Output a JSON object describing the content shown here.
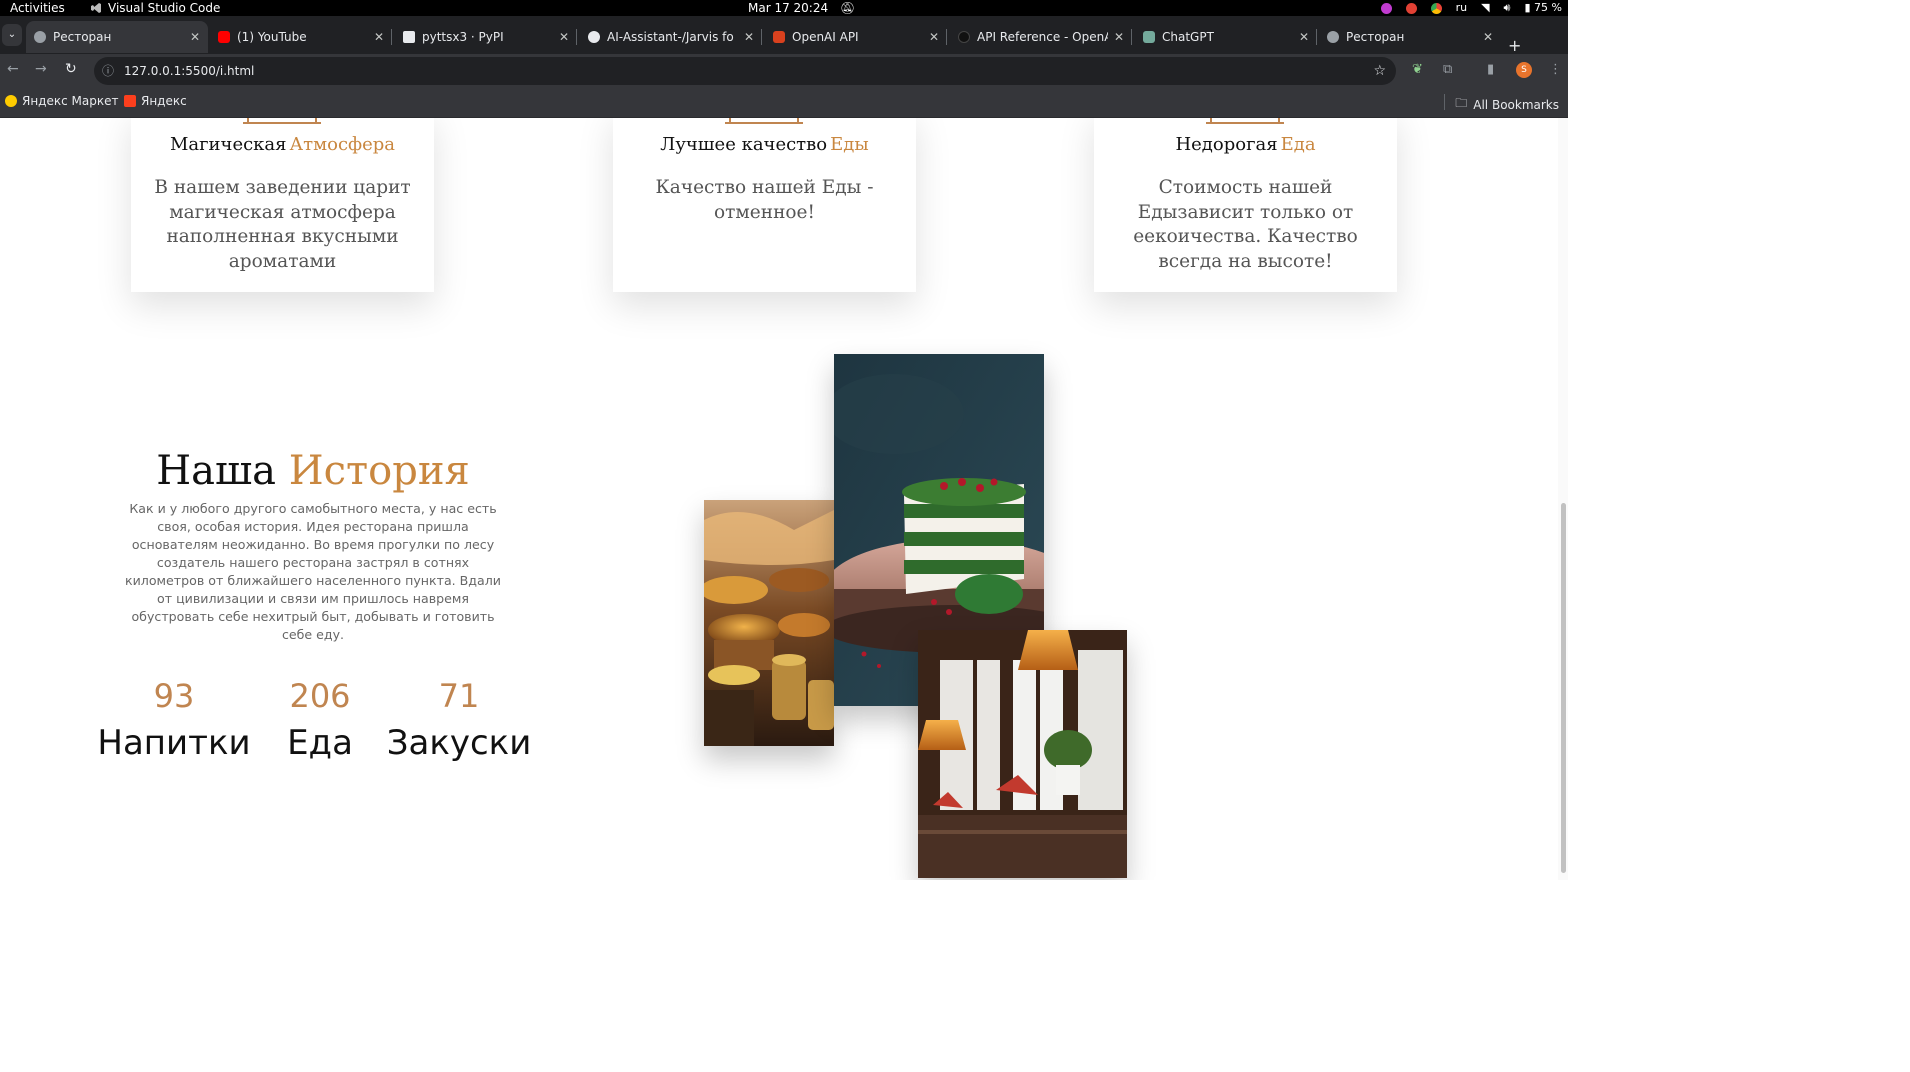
{
  "os_bar": {
    "activities": "Activities",
    "app_name": "Visual Studio Code",
    "clock": "Mar 17  20:24",
    "language": "ru",
    "battery": "75 %"
  },
  "browser": {
    "tabs": [
      {
        "label": "Ресторан",
        "active": true,
        "favicon_color": "#9aa0a6"
      },
      {
        "label": "(1) YouTube",
        "active": false,
        "favicon_color": "#ff0000"
      },
      {
        "label": "pyttsx3 · PyPI",
        "active": false,
        "favicon_color": "#e8eaed"
      },
      {
        "label": "AI-Assistant-/Jarvis fo",
        "active": false,
        "favicon_color": "#e8eaed"
      },
      {
        "label": "OpenAI API",
        "active": false,
        "favicon_color": "#d9411e"
      },
      {
        "label": "API Reference - OpenA",
        "active": false,
        "favicon_color": "#111111"
      },
      {
        "label": "ChatGPT",
        "active": false,
        "favicon_color": "#74aa9c"
      },
      {
        "label": "Ресторан",
        "active": false,
        "favicon_color": "#9aa0a6"
      }
    ],
    "url": "127.0.0.1:5500/i.html",
    "profile_initial": "S",
    "bookmarks": [
      {
        "label": "Яндекс Маркет",
        "icon_color": "#ffcc00"
      },
      {
        "label": "Яндекс",
        "icon_color": "#fc3f1d"
      }
    ],
    "all_bookmarks": "All Bookmarks"
  },
  "features": [
    {
      "title": "Магическая",
      "accent": "Атмосфера",
      "text": "В нашем заведении царит магическая атмосфера наполненная вкусными ароматами"
    },
    {
      "title": "Лучшее качество",
      "accent": "Еды",
      "text": "Качество нашей Еды - отменное!"
    },
    {
      "title": "Недорогая",
      "accent": "Еда",
      "text": "Стоимость нашей Едызависит только от еекоичества. Качество всегда на высоте!"
    }
  ],
  "history": {
    "title": "Наша",
    "accent": "История",
    "text": "Как и у любого другого самобытного места, у нас есть своя, особая история. Идея ресторана пришла основателям неожиданно. Во время прогулки по лесу создатель нашего ресторана застрял в сотнях километров от ближайшего населенного пункта. Вдали от цивилизации и связи им пришлось навремя обустровать себе нехитрый быт, добывать и готовить себе еду."
  },
  "stats": [
    {
      "value": "93",
      "label": "Напитки"
    },
    {
      "value": "206",
      "label": "Еда"
    },
    {
      "value": "71",
      "label": "Закуски"
    }
  ],
  "colors": {
    "accent": "#c9873f",
    "stat_number": "#c08550"
  }
}
